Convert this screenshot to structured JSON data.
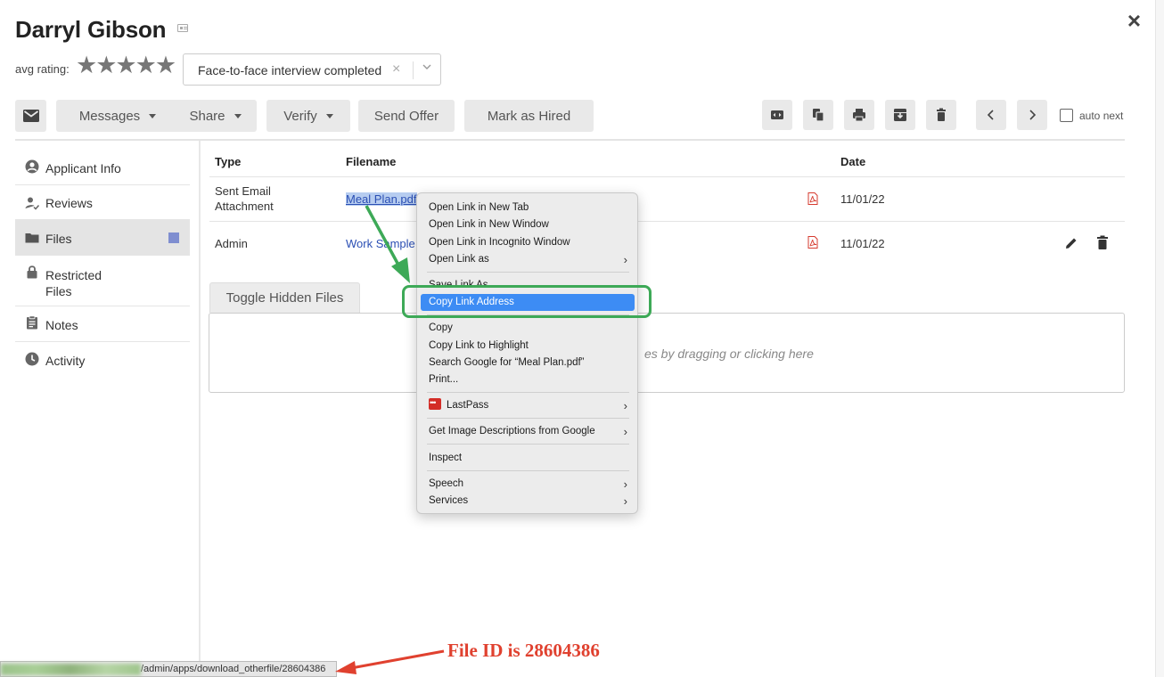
{
  "applicant": {
    "name": "Darryl Gibson",
    "avg_rating_label": "avg rating:",
    "stars": "★★★★★"
  },
  "status": {
    "value": "Face-to-face interview completed",
    "clear": "×",
    "chevron": "⌄"
  },
  "close": "×",
  "toolbar": {
    "messages": "Messages",
    "share": "Share",
    "verify": "Verify",
    "send_offer": "Send Offer",
    "mark_hired": "Mark as Hired",
    "auto_next": "auto next"
  },
  "sidebar": {
    "items": [
      {
        "label": "Applicant Info",
        "icon": "account-circle-icon"
      },
      {
        "label": "Reviews",
        "icon": "person-check-icon"
      },
      {
        "label": "Files",
        "icon": "folder-icon"
      },
      {
        "label": "Restricted",
        "label2": "Files",
        "icon": "lock-icon"
      },
      {
        "label": "Notes",
        "icon": "clipboard-icon"
      },
      {
        "label": "Activity",
        "icon": "clock-icon"
      }
    ]
  },
  "table": {
    "headers": {
      "type": "Type",
      "filename": "Filename",
      "date": "Date"
    },
    "rows": [
      {
        "type": "Sent Email",
        "type2": "Attachment",
        "filename": "Meal Plan.pdf",
        "date": "11/01/22"
      },
      {
        "type": "Admin",
        "filename": "Work Sample",
        "date": "11/01/22"
      }
    ]
  },
  "files": {
    "toggle_hidden": "Toggle Hidden Files",
    "drop_text": "es by dragging or clicking here"
  },
  "context_menu": {
    "items": [
      "Open Link in New Tab",
      "Open Link in New Window",
      "Open Link in Incognito Window",
      "Open Link as",
      "Save Link As...",
      "Copy Link Address",
      "Copy",
      "Copy Link to Highlight",
      "Search Google for “Meal Plan.pdf”",
      "Print...",
      "LastPass",
      "Get Image Descriptions from Google",
      "Inspect",
      "Speech",
      "Services"
    ],
    "submenu_arrow": "›"
  },
  "statusbar": {
    "url": "/admin/apps/download_otherfile/28604386"
  },
  "annotation": {
    "text": "File ID is 28604386"
  },
  "colors": {
    "highlight": "#3d8cf4",
    "annotation_green": "#3da957",
    "annotation_red": "#e0412f",
    "link": "#2b4fb4",
    "files_badge": "#7f8ed0"
  }
}
